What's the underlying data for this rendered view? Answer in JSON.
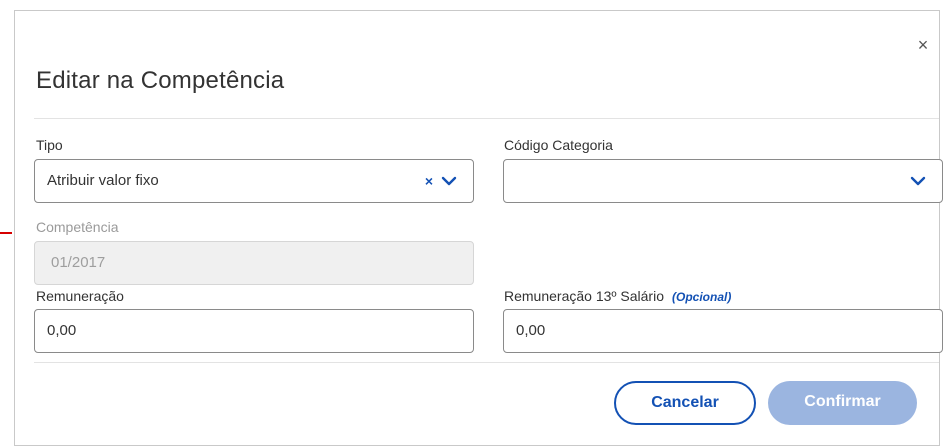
{
  "dialog": {
    "title": "Editar na Competência",
    "close_symbol": "×"
  },
  "fields": {
    "tipo": {
      "label": "Tipo",
      "value": "Atribuir valor fixo",
      "clear_symbol": "×"
    },
    "codigo_categoria": {
      "label": "Código Categoria",
      "value": ""
    },
    "competencia": {
      "label": "Competência",
      "value": "01/2017",
      "disabled": true
    },
    "remuneracao": {
      "label": "Remuneração",
      "value": "0,00"
    },
    "remuneracao_13": {
      "label": "Remuneração 13º Salário",
      "optional_tag": "(Opcional)",
      "value": "0,00"
    }
  },
  "buttons": {
    "cancel": "Cancelar",
    "confirm": "Confirmar"
  },
  "icons": {
    "close": "close-icon",
    "clear": "clear-icon",
    "dropdown": "chevron-down-icon"
  },
  "colors": {
    "primary": "#1351b4",
    "confirm_disabled": "#9bb5e0",
    "marker": "#d60000"
  }
}
